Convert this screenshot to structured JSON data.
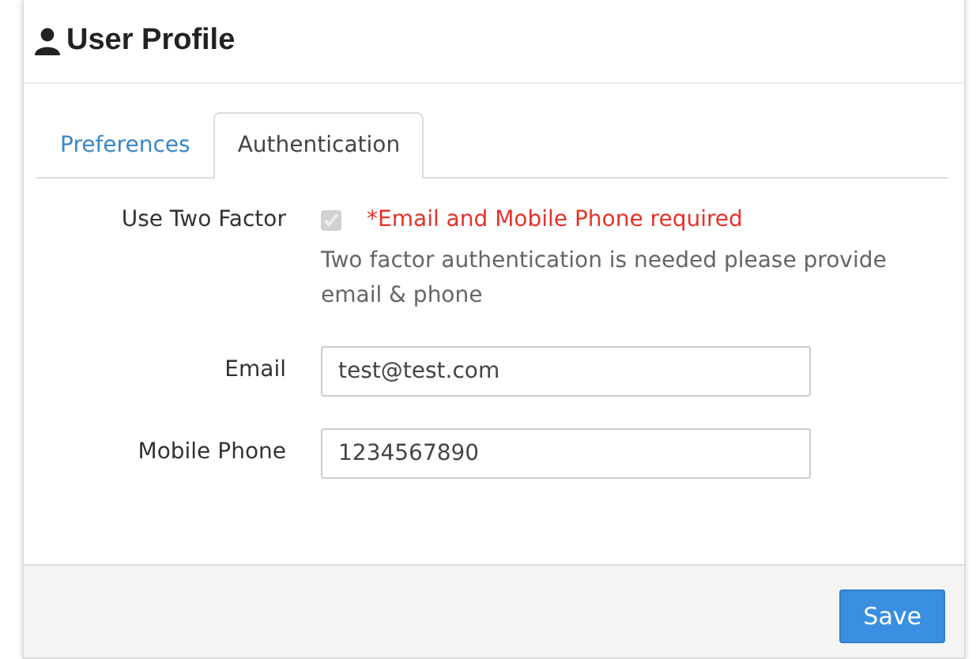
{
  "panel": {
    "title": "User Profile"
  },
  "tabs": [
    {
      "label": "Preferences",
      "selected": false
    },
    {
      "label": "Authentication",
      "selected": true
    }
  ],
  "two_factor": {
    "label": "Use Two Factor",
    "checked": true,
    "disabled": true,
    "warning": "*Email and Mobile Phone required",
    "help": "Two factor authentication is needed please provide email & phone"
  },
  "fields": [
    {
      "label": "Email",
      "value": "test@test.com"
    },
    {
      "label": "Mobile Phone",
      "value": "1234567890"
    }
  ],
  "footer": {
    "button": "Save"
  }
}
